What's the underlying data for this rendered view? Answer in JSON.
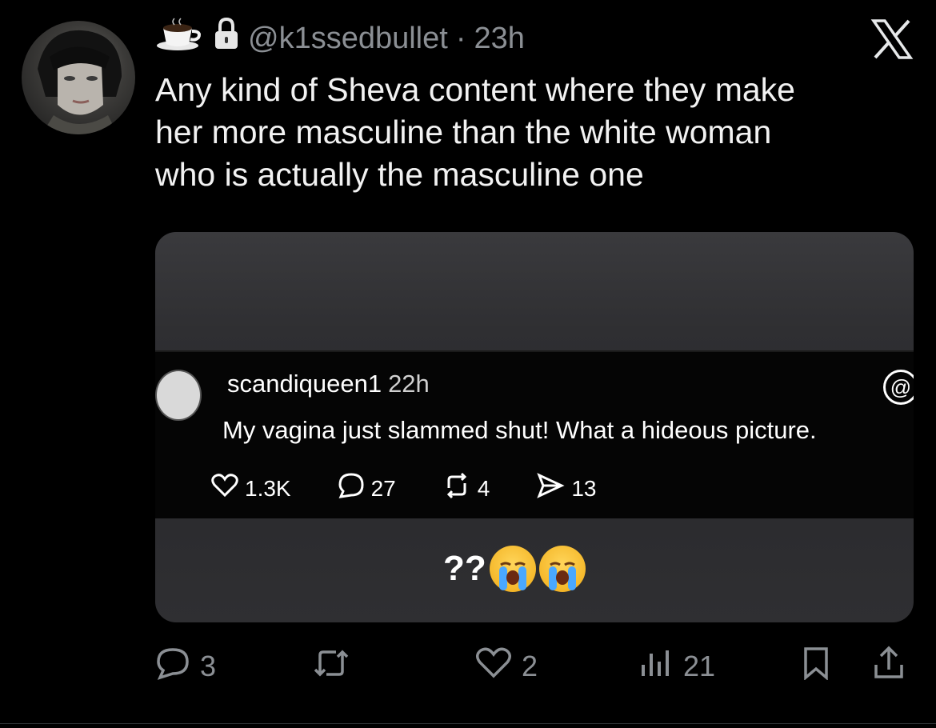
{
  "tweet": {
    "handle": "@k1ssedbullet",
    "separator": "·",
    "time": "23h",
    "text": "Any kind of Sheva content where they make\nher more masculine than the white woman\nwho is actually the masculine one"
  },
  "embedded": {
    "username": "scandiqueen1",
    "time": "22h",
    "text": "My vagina just slammed shut! What a hideous picture.",
    "likes": "1.3K",
    "replies": "27",
    "reposts": "4",
    "shares": "13",
    "caption": "??"
  },
  "actions": {
    "replies": "3",
    "likes": "2",
    "views": "21"
  },
  "icons": {
    "status_emoji": "coffee-cup-icon",
    "lock": "lock-icon",
    "close": "x-logo-icon"
  }
}
